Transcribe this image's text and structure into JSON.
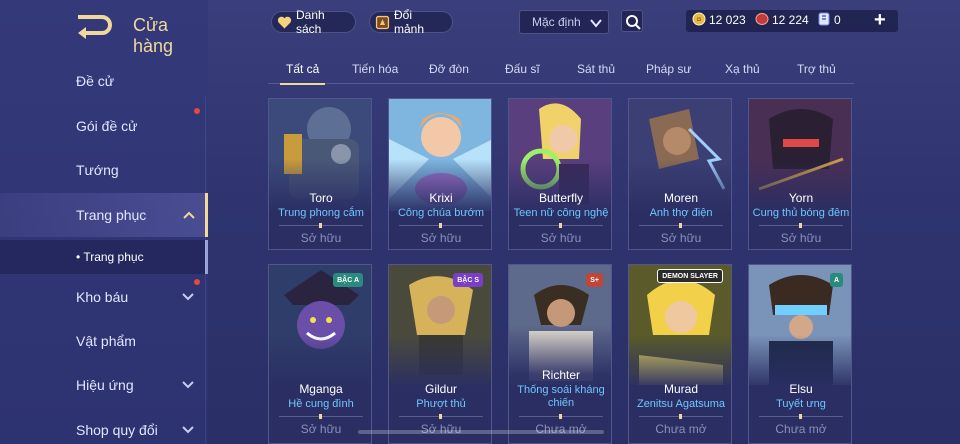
{
  "header": {
    "title": "Cửa hàng"
  },
  "sidebar": {
    "items": [
      {
        "label": "Đề cử"
      },
      {
        "label": "Gói đề cử"
      },
      {
        "label": "Tướng"
      },
      {
        "label": "Trang phục"
      },
      {
        "label": "Kho báu"
      },
      {
        "label": "Vật phẩm"
      },
      {
        "label": "Hiệu ứng"
      },
      {
        "label": "Shop quy đổi"
      }
    ],
    "sub_item": "• Trang phục"
  },
  "toolbar": {
    "list_label": "Danh sách",
    "exchange_label": "Đổi mảnh",
    "sort_value": "Mặc định"
  },
  "currency": {
    "gold": "12 023",
    "vouchers": "12 224",
    "tickets": "0"
  },
  "tabs": [
    "Tất cả",
    "Tiến hóa",
    "Đỡ đòn",
    "Đấu sĩ",
    "Sát thủ",
    "Pháp sư",
    "Xạ thủ",
    "Trợ thủ"
  ],
  "cards": [
    {
      "hero": "Toro",
      "skin": "Trung phong cắm",
      "status": "Sở hữu",
      "badge": ""
    },
    {
      "hero": "Krixi",
      "skin": "Công chúa bướm",
      "status": "Sở hữu",
      "badge": ""
    },
    {
      "hero": "Butterfly",
      "skin": "Teen nữ công nghệ",
      "status": "Sở hữu",
      "badge": ""
    },
    {
      "hero": "Moren",
      "skin": "Anh thợ điện",
      "status": "Sở hữu",
      "badge": ""
    },
    {
      "hero": "Yorn",
      "skin": "Cung thủ bóng đêm",
      "status": "Sở hữu",
      "badge": ""
    },
    {
      "hero": "Mganga",
      "skin": "Hề cung đình",
      "status": "Sở hữu",
      "badge": "BẬC A"
    },
    {
      "hero": "Gildur",
      "skin": "Phượt thủ",
      "status": "Sở hữu",
      "badge": "BẬC S"
    },
    {
      "hero": "Richter",
      "skin": "Thống soái kháng chiến",
      "status": "Chưa mở",
      "badge": "S+"
    },
    {
      "hero": "Murad",
      "skin": "Zenitsu Agatsuma",
      "status": "Chưa mở",
      "badge": "DEMON SLAYER"
    },
    {
      "hero": "Elsu",
      "skin": "Tuyết ưng",
      "status": "Chưa mở",
      "badge": "A"
    }
  ],
  "colors": {
    "accent_gold": "#f0d89a",
    "skin_blue": "#6fc6ff",
    "notification_red": "#e4483e"
  }
}
